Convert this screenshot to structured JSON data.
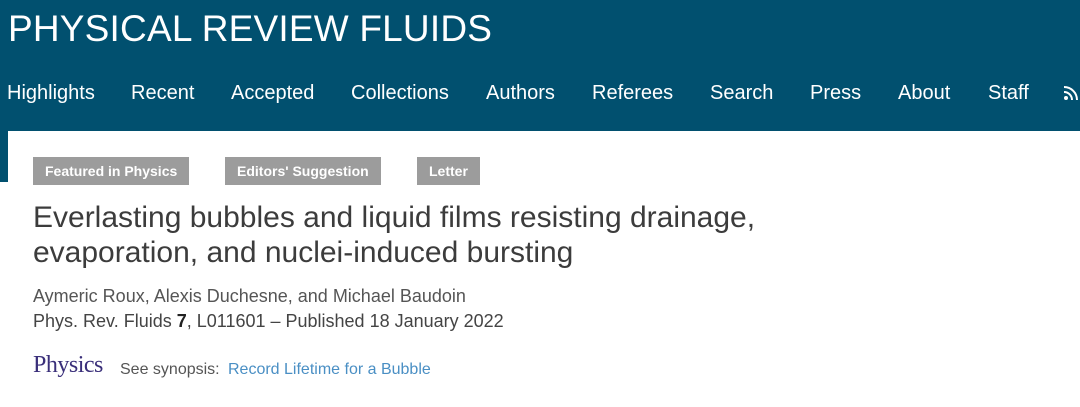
{
  "header": {
    "journal_title": "PHYSICAL REVIEW FLUIDS",
    "background_color": "#01506f",
    "nav": [
      {
        "id": "highlights",
        "label": "Highlights"
      },
      {
        "id": "recent",
        "label": "Recent"
      },
      {
        "id": "accepted",
        "label": "Accepted"
      },
      {
        "id": "collections",
        "label": "Collections"
      },
      {
        "id": "authors",
        "label": "Authors"
      },
      {
        "id": "referees",
        "label": "Referees"
      },
      {
        "id": "search",
        "label": "Search"
      },
      {
        "id": "press",
        "label": "Press"
      },
      {
        "id": "about",
        "label": "About"
      },
      {
        "id": "staff",
        "label": "Staff"
      }
    ],
    "rss_icon": "rss-icon"
  },
  "article": {
    "badges": [
      "Featured in Physics",
      "Editors' Suggestion",
      "Letter"
    ],
    "badge_color": "#9c9c9c",
    "title_line1": "Everlasting bubbles and liquid films resisting drainage,",
    "title_line2": "evaporation, and nuclei-induced bursting",
    "authors": "Aymeric Roux, Alexis Duchesne, and Michael Baudoin",
    "citation": {
      "journal": "Phys. Rev. Fluids",
      "volume": "7",
      "rest": ", L011601 – Published 18 January 2022"
    },
    "synopsis": {
      "logo_text": "Physics",
      "label": "See synopsis:",
      "link_text": "Record Lifetime for a Bubble",
      "link_color": "#4a8fc4"
    }
  }
}
